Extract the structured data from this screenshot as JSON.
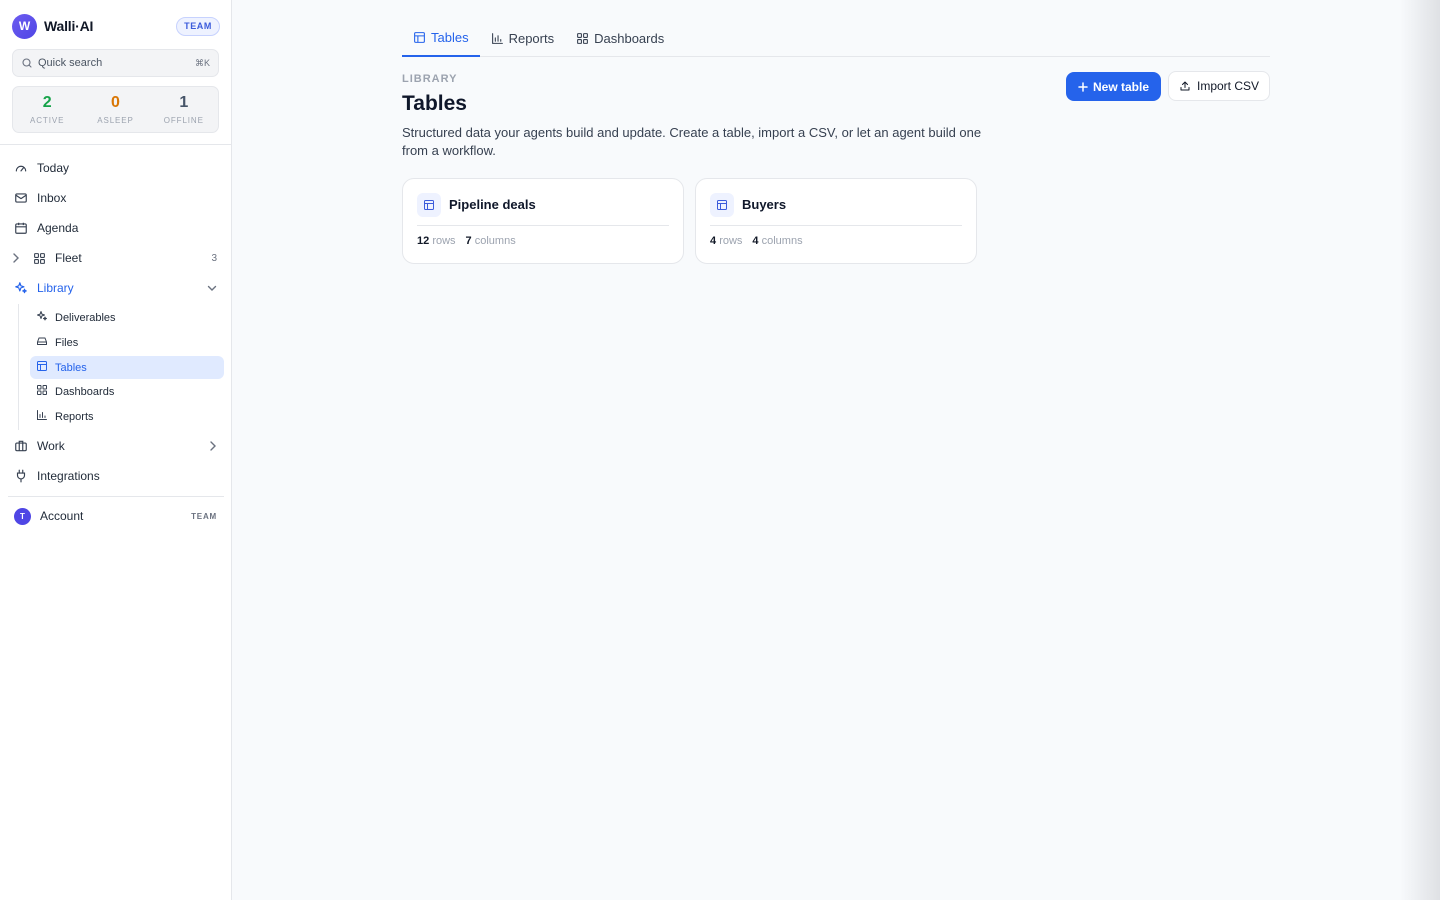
{
  "app": {
    "name": "Walli·AI",
    "logo_letter": "W",
    "plan_badge": "TEAM"
  },
  "search": {
    "placeholder": "Quick search",
    "shortcut": "⌘K"
  },
  "fleet_status": [
    {
      "value": "2",
      "label": "ACTIVE",
      "color": "#16a34a"
    },
    {
      "value": "0",
      "label": "ASLEEP",
      "color": "#d97706"
    },
    {
      "value": "1",
      "label": "OFFLINE",
      "color": "#475569"
    }
  ],
  "nav": {
    "today": {
      "label": "Today",
      "icon": "gauge-icon"
    },
    "inbox": {
      "label": "Inbox",
      "icon": "mail-icon"
    },
    "agenda": {
      "label": "Agenda",
      "icon": "calendar-icon"
    },
    "fleet": {
      "label": "Fleet",
      "count": "3",
      "icon": "grid-icon"
    },
    "library": {
      "label": "Library",
      "icon": "sparkles-icon",
      "expanded": true
    },
    "library_items": [
      {
        "label": "Deliverables",
        "icon": "sparkles-icon"
      },
      {
        "label": "Files",
        "icon": "drive-icon"
      },
      {
        "label": "Tables",
        "icon": "table-icon",
        "active": true
      },
      {
        "label": "Dashboards",
        "icon": "dashboard-icon"
      },
      {
        "label": "Reports",
        "icon": "bar-chart-icon"
      }
    ],
    "work": {
      "label": "Work",
      "icon": "briefcase-icon"
    },
    "integrations": {
      "label": "Integrations",
      "icon": "plug-icon"
    }
  },
  "account": {
    "label": "Account",
    "avatar_letter": "T",
    "plan": "TEAM"
  },
  "tabs": [
    {
      "label": "Tables",
      "active": true
    },
    {
      "label": "Reports",
      "active": false
    },
    {
      "label": "Dashboards",
      "active": false
    }
  ],
  "page": {
    "eyebrow": "LIBRARY",
    "title": "Tables",
    "description": "Structured data your agents build and update. Create a table, import a CSV, or let an agent build one from a workflow.",
    "new_button": "New table",
    "import_button": "Import CSV"
  },
  "tables": [
    {
      "name": "Pipeline deals",
      "rows": "12",
      "rows_label": "rows",
      "columns": "7",
      "columns_label": "columns"
    },
    {
      "name": "Buyers",
      "rows": "4",
      "rows_label": "rows",
      "columns": "4",
      "columns_label": "columns"
    }
  ],
  "colors": {
    "accent": "#2563eb",
    "active_bg": "#e0eaff",
    "brand": "#4f46e5"
  }
}
